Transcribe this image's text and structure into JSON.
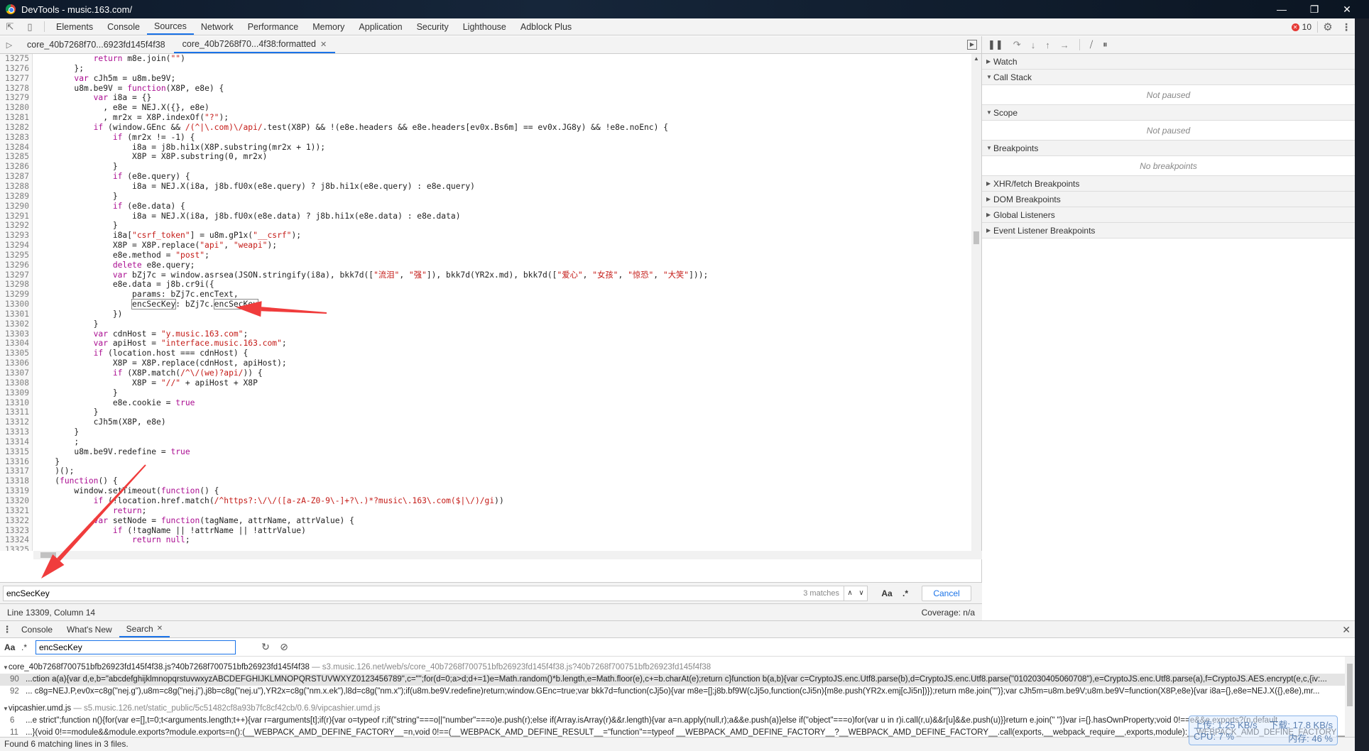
{
  "window": {
    "title": "DevTools - music.163.com/",
    "controls": [
      "minimize",
      "restore",
      "close"
    ]
  },
  "main_tabs": [
    "Elements",
    "Console",
    "Sources",
    "Network",
    "Performance",
    "Memory",
    "Application",
    "Security",
    "Lighthouse",
    "Adblock Plus"
  ],
  "active_main_tab": "Sources",
  "error_count": "10",
  "file_tabs": [
    {
      "label": "core_40b7268f70...6923fd145f4f38",
      "closable": false
    },
    {
      "label": "core_40b7268f70...4f38:formatted",
      "closable": true
    }
  ],
  "code_lines": [
    {
      "n": "13275",
      "t": "            return m8e.join(\"\")"
    },
    {
      "n": "13276",
      "t": "        };"
    },
    {
      "n": "13277",
      "t": "        var cJh5m = u8m.be9V;"
    },
    {
      "n": "13278",
      "t": "        u8m.be9V = function(X8P, e8e) {"
    },
    {
      "n": "13279",
      "t": "            var i8a = {}"
    },
    {
      "n": "13280",
      "t": "              , e8e = NEJ.X({}, e8e)"
    },
    {
      "n": "13281",
      "t": "              , mr2x = X8P.indexOf(\"?\");"
    },
    {
      "n": "13282",
      "t": "            if (window.GEnc && /(^|\\.com)\\/api/.test(X8P) && !(e8e.headers && e8e.headers[ev0x.Bs6m] == ev0x.JG8y) && !e8e.noEnc) {"
    },
    {
      "n": "13283",
      "t": "                if (mr2x != -1) {"
    },
    {
      "n": "13284",
      "t": "                    i8a = j8b.hi1x(X8P.substring(mr2x + 1));"
    },
    {
      "n": "13285",
      "t": "                    X8P = X8P.substring(0, mr2x)"
    },
    {
      "n": "13286",
      "t": "                }"
    },
    {
      "n": "13287",
      "t": "                if (e8e.query) {"
    },
    {
      "n": "13288",
      "t": "                    i8a = NEJ.X(i8a, j8b.fU0x(e8e.query) ? j8b.hi1x(e8e.query) : e8e.query)"
    },
    {
      "n": "13289",
      "t": "                }"
    },
    {
      "n": "13290",
      "t": "                if (e8e.data) {"
    },
    {
      "n": "13291",
      "t": "                    i8a = NEJ.X(i8a, j8b.fU0x(e8e.data) ? j8b.hi1x(e8e.data) : e8e.data)"
    },
    {
      "n": "13292",
      "t": "                }"
    },
    {
      "n": "13293",
      "t": "                i8a[\"csrf_token\"] = u8m.gP1x(\"__csrf\");"
    },
    {
      "n": "13294",
      "t": "                X8P = X8P.replace(\"api\", \"weapi\");"
    },
    {
      "n": "13295",
      "t": "                e8e.method = \"post\";"
    },
    {
      "n": "13296",
      "t": "                delete e8e.query;"
    },
    {
      "n": "13297",
      "t": "                var bZj7c = window.asrsea(JSON.stringify(i8a), bkk7d([\"流泪\", \"强\"]), bkk7d(YR2x.md), bkk7d([\"爱心\", \"女孩\", \"惊恐\", \"大笑\"]));"
    },
    {
      "n": "13298",
      "t": "                e8e.data = j8b.cr9i({"
    },
    {
      "n": "13299",
      "t": "                    params: bZj7c.encText,"
    },
    {
      "n": "13300",
      "t": "                    encSecKey: bZj7c.encSecKey"
    },
    {
      "n": "13301",
      "t": "                })"
    },
    {
      "n": "13302",
      "t": "            }"
    },
    {
      "n": "13303",
      "t": "            var cdnHost = \"y.music.163.com\";"
    },
    {
      "n": "13304",
      "t": "            var apiHost = \"interface.music.163.com\";"
    },
    {
      "n": "13305",
      "t": "            if (location.host === cdnHost) {"
    },
    {
      "n": "13306",
      "t": "                X8P = X8P.replace(cdnHost, apiHost);"
    },
    {
      "n": "13307",
      "t": "                if (X8P.match(/^\\/(we)?api/)) {"
    },
    {
      "n": "13308",
      "t": "                    X8P = \"//\" + apiHost + X8P"
    },
    {
      "n": "13309",
      "t": "                }"
    },
    {
      "n": "13310",
      "t": "                e8e.cookie = true"
    },
    {
      "n": "13311",
      "t": "            }"
    },
    {
      "n": "13312",
      "t": "            cJh5m(X8P, e8e)"
    },
    {
      "n": "13313",
      "t": "        }"
    },
    {
      "n": "13314",
      "t": "        ;"
    },
    {
      "n": "13315",
      "t": "        u8m.be9V.redefine = true"
    },
    {
      "n": "13316",
      "t": "    }"
    },
    {
      "n": "13317",
      "t": "    )();"
    },
    {
      "n": "13318",
      "t": "    (function() {"
    },
    {
      "n": "13319",
      "t": "        window.setTimeout(function() {"
    },
    {
      "n": "13320",
      "t": "            if (!location.href.match(/^https?:\\/\\/([a-zA-Z0-9\\-]+?\\.)*?music\\.163\\.com($|\\/)/gi))"
    },
    {
      "n": "13321",
      "t": "                return;"
    },
    {
      "n": "13322",
      "t": "            var setNode = function(tagName, attrName, attrValue) {"
    },
    {
      "n": "13323",
      "t": "                if (!tagName || !attrName || !attrValue)"
    },
    {
      "n": "13324",
      "t": "                    return null;"
    },
    {
      "n": "13325",
      "t": ""
    }
  ],
  "find": {
    "query": "encSecKey",
    "matches": "3 matches",
    "case_label": "Aa",
    "regex_label": ".*",
    "cancel_label": "Cancel"
  },
  "status": {
    "cursor": "Line 13309, Column 14",
    "coverage": "Coverage: n/a"
  },
  "sidebar": {
    "panes": [
      {
        "label": "Watch",
        "expanded": false,
        "body": null
      },
      {
        "label": "Call Stack",
        "expanded": true,
        "body": "Not paused"
      },
      {
        "label": "Scope",
        "expanded": true,
        "body": "Not paused"
      },
      {
        "label": "Breakpoints",
        "expanded": true,
        "body": "No breakpoints"
      },
      {
        "label": "XHR/fetch Breakpoints",
        "expanded": false,
        "body": null
      },
      {
        "label": "DOM Breakpoints",
        "expanded": false,
        "body": null
      },
      {
        "label": "Global Listeners",
        "expanded": false,
        "body": null
      },
      {
        "label": "Event Listener Breakpoints",
        "expanded": false,
        "body": null
      }
    ]
  },
  "drawer": {
    "tabs": [
      {
        "label": "Console",
        "closable": false
      },
      {
        "label": "What's New",
        "closable": false
      },
      {
        "label": "Search",
        "closable": true
      }
    ],
    "active_tab": "Search",
    "search": {
      "case_label": "Aa",
      "regex_label": ".*",
      "query": "encSecKey"
    },
    "results": [
      {
        "file": "core_40b7268f700751bfb26923fd145f4f38.js?40b7268f700751bfb26923fd145f4f38",
        "url": "— s3.music.126.net/web/s/core_40b7268f700751bfb26923fd145f4f38.js?40b7268f700751bfb26923fd145f4f38",
        "lines": [
          {
            "n": "90",
            "t": "...ction a(a){var d,e,b=\"abcdefghijklmnopqrstuvwxyzABCDEFGHIJKLMNOPQRSTUVWXYZ0123456789\",c=\"\";for(d=0;a>d;d+=1)e=Math.random()*b.length,e=Math.floor(e),c+=b.charAt(e);return c}function b(a,b){var c=CryptoJS.enc.Utf8.parse(b),d=CryptoJS.enc.Utf8.parse(\"0102030405060708\"),e=CryptoJS.enc.Utf8.parse(a),f=CryptoJS.AES.encrypt(e,c,{iv:...",
            "selected": true
          },
          {
            "n": "92",
            "t": "... c8g=NEJ.P,ev0x=c8g(\"nej.g\"),u8m=c8g(\"nej.j\"),j8b=c8g(\"nej.u\"),YR2x=c8g(\"nm.x.ek\"),l8d=c8g(\"nm.x\");if(u8m.be9V.redefine)return;window.GEnc=true;var bkk7d=function(cJj5o){var m8e=[];j8b.bf9W(cJj5o,function(cJi5n){m8e.push(YR2x.emj[cJi5n])});return m8e.join(\"\")};var cJh5m=u8m.be9V;u8m.be9V=function(X8P,e8e){var i8a={},e8e=NEJ.X({},e8e),mr...",
            "selected": false
          }
        ]
      },
      {
        "file": "vipcashier.umd.js",
        "url": "— s5.music.126.net/static_public/5c51482cf8a93b7fc8cf42cb/0.6.9/vipcashier.umd.js",
        "lines": [
          {
            "n": "6",
            "t": "...e strict\";function n(){for(var e=[],t=0;t<arguments.length;t++){var r=arguments[t];if(r){var o=typeof r;if(\"string\"===o||\"number\"===o)e.push(r);else if(Array.isArray(r)&&r.length){var a=n.apply(null,r);a&&e.push(a)}else if(\"object\"===o)for(var u in r)i.call(r,u)&&r[u]&&e.push(u)}}return e.join(\" \")}var i={}.hasOwnProperty;void 0!==e&&e.exports?(n.default",
            "selected": false
          },
          {
            "n": "11",
            "t": "...}(void 0!==module&&module.exports?module.exports=n():(__WEBPACK_AMD_DEFINE_FACTORY__=n,void 0!==(__WEBPACK_AMD_DEFINE_RESULT__=\"function\"==typeof __WEBPACK_AMD_DEFINE_FACTORY__?__WEBPACK_AMD_DEFINE_FACTORY__.call(exports,__webpack_require__,exports,module):__WEBPACK_AMD_DEFINE_FACTORY__)&&(module...",
            "selected": false
          }
        ]
      }
    ],
    "summary": "Found 6 matching lines in 3 files."
  },
  "net_widget": {
    "upload": "上传: 1.25 KB/s",
    "download": "下载: 17.8 KB/s",
    "cpu": "CPU: 7 %",
    "memory": "内存: 46 %"
  },
  "annotation_color": "#f03c3c"
}
